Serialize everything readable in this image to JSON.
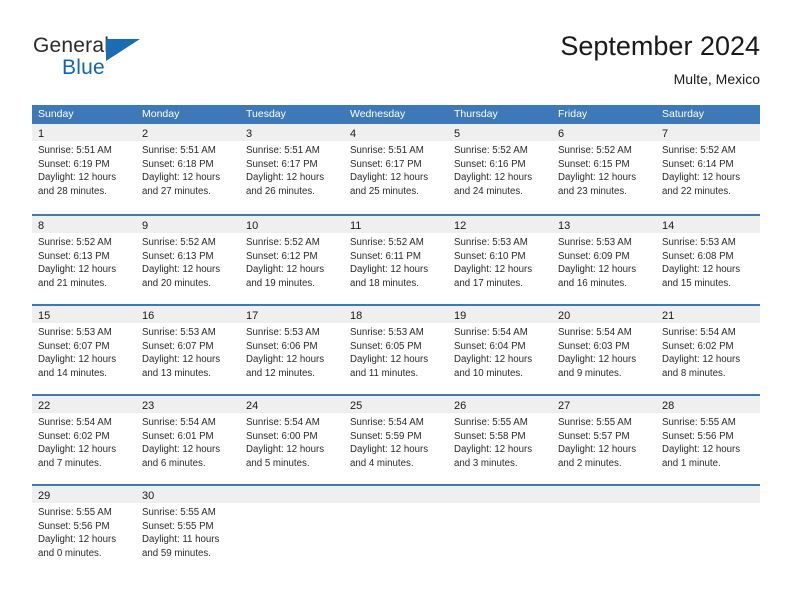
{
  "brand": {
    "word_general": "General",
    "word_blue": "Blue",
    "accent_color": "#1b6cb3"
  },
  "header": {
    "title": "September 2024",
    "location": "Multe, Mexico"
  },
  "theme": {
    "header_blue": "#3d79b9",
    "band_gray": "#efefef",
    "text_color": "#2a2a2a"
  },
  "weekdays": [
    "Sunday",
    "Monday",
    "Tuesday",
    "Wednesday",
    "Thursday",
    "Friday",
    "Saturday"
  ],
  "weeks": [
    [
      {
        "day": "1",
        "sunrise": "Sunrise: 5:51 AM",
        "sunset": "Sunset: 6:19 PM",
        "daylight1": "Daylight: 12 hours",
        "daylight2": "and 28 minutes."
      },
      {
        "day": "2",
        "sunrise": "Sunrise: 5:51 AM",
        "sunset": "Sunset: 6:18 PM",
        "daylight1": "Daylight: 12 hours",
        "daylight2": "and 27 minutes."
      },
      {
        "day": "3",
        "sunrise": "Sunrise: 5:51 AM",
        "sunset": "Sunset: 6:17 PM",
        "daylight1": "Daylight: 12 hours",
        "daylight2": "and 26 minutes."
      },
      {
        "day": "4",
        "sunrise": "Sunrise: 5:51 AM",
        "sunset": "Sunset: 6:17 PM",
        "daylight1": "Daylight: 12 hours",
        "daylight2": "and 25 minutes."
      },
      {
        "day": "5",
        "sunrise": "Sunrise: 5:52 AM",
        "sunset": "Sunset: 6:16 PM",
        "daylight1": "Daylight: 12 hours",
        "daylight2": "and 24 minutes."
      },
      {
        "day": "6",
        "sunrise": "Sunrise: 5:52 AM",
        "sunset": "Sunset: 6:15 PM",
        "daylight1": "Daylight: 12 hours",
        "daylight2": "and 23 minutes."
      },
      {
        "day": "7",
        "sunrise": "Sunrise: 5:52 AM",
        "sunset": "Sunset: 6:14 PM",
        "daylight1": "Daylight: 12 hours",
        "daylight2": "and 22 minutes."
      }
    ],
    [
      {
        "day": "8",
        "sunrise": "Sunrise: 5:52 AM",
        "sunset": "Sunset: 6:13 PM",
        "daylight1": "Daylight: 12 hours",
        "daylight2": "and 21 minutes."
      },
      {
        "day": "9",
        "sunrise": "Sunrise: 5:52 AM",
        "sunset": "Sunset: 6:13 PM",
        "daylight1": "Daylight: 12 hours",
        "daylight2": "and 20 minutes."
      },
      {
        "day": "10",
        "sunrise": "Sunrise: 5:52 AM",
        "sunset": "Sunset: 6:12 PM",
        "daylight1": "Daylight: 12 hours",
        "daylight2": "and 19 minutes."
      },
      {
        "day": "11",
        "sunrise": "Sunrise: 5:52 AM",
        "sunset": "Sunset: 6:11 PM",
        "daylight1": "Daylight: 12 hours",
        "daylight2": "and 18 minutes."
      },
      {
        "day": "12",
        "sunrise": "Sunrise: 5:53 AM",
        "sunset": "Sunset: 6:10 PM",
        "daylight1": "Daylight: 12 hours",
        "daylight2": "and 17 minutes."
      },
      {
        "day": "13",
        "sunrise": "Sunrise: 5:53 AM",
        "sunset": "Sunset: 6:09 PM",
        "daylight1": "Daylight: 12 hours",
        "daylight2": "and 16 minutes."
      },
      {
        "day": "14",
        "sunrise": "Sunrise: 5:53 AM",
        "sunset": "Sunset: 6:08 PM",
        "daylight1": "Daylight: 12 hours",
        "daylight2": "and 15 minutes."
      }
    ],
    [
      {
        "day": "15",
        "sunrise": "Sunrise: 5:53 AM",
        "sunset": "Sunset: 6:07 PM",
        "daylight1": "Daylight: 12 hours",
        "daylight2": "and 14 minutes."
      },
      {
        "day": "16",
        "sunrise": "Sunrise: 5:53 AM",
        "sunset": "Sunset: 6:07 PM",
        "daylight1": "Daylight: 12 hours",
        "daylight2": "and 13 minutes."
      },
      {
        "day": "17",
        "sunrise": "Sunrise: 5:53 AM",
        "sunset": "Sunset: 6:06 PM",
        "daylight1": "Daylight: 12 hours",
        "daylight2": "and 12 minutes."
      },
      {
        "day": "18",
        "sunrise": "Sunrise: 5:53 AM",
        "sunset": "Sunset: 6:05 PM",
        "daylight1": "Daylight: 12 hours",
        "daylight2": "and 11 minutes."
      },
      {
        "day": "19",
        "sunrise": "Sunrise: 5:54 AM",
        "sunset": "Sunset: 6:04 PM",
        "daylight1": "Daylight: 12 hours",
        "daylight2": "and 10 minutes."
      },
      {
        "day": "20",
        "sunrise": "Sunrise: 5:54 AM",
        "sunset": "Sunset: 6:03 PM",
        "daylight1": "Daylight: 12 hours",
        "daylight2": "and 9 minutes."
      },
      {
        "day": "21",
        "sunrise": "Sunrise: 5:54 AM",
        "sunset": "Sunset: 6:02 PM",
        "daylight1": "Daylight: 12 hours",
        "daylight2": "and 8 minutes."
      }
    ],
    [
      {
        "day": "22",
        "sunrise": "Sunrise: 5:54 AM",
        "sunset": "Sunset: 6:02 PM",
        "daylight1": "Daylight: 12 hours",
        "daylight2": "and 7 minutes."
      },
      {
        "day": "23",
        "sunrise": "Sunrise: 5:54 AM",
        "sunset": "Sunset: 6:01 PM",
        "daylight1": "Daylight: 12 hours",
        "daylight2": "and 6 minutes."
      },
      {
        "day": "24",
        "sunrise": "Sunrise: 5:54 AM",
        "sunset": "Sunset: 6:00 PM",
        "daylight1": "Daylight: 12 hours",
        "daylight2": "and 5 minutes."
      },
      {
        "day": "25",
        "sunrise": "Sunrise: 5:54 AM",
        "sunset": "Sunset: 5:59 PM",
        "daylight1": "Daylight: 12 hours",
        "daylight2": "and 4 minutes."
      },
      {
        "day": "26",
        "sunrise": "Sunrise: 5:55 AM",
        "sunset": "Sunset: 5:58 PM",
        "daylight1": "Daylight: 12 hours",
        "daylight2": "and 3 minutes."
      },
      {
        "day": "27",
        "sunrise": "Sunrise: 5:55 AM",
        "sunset": "Sunset: 5:57 PM",
        "daylight1": "Daylight: 12 hours",
        "daylight2": "and 2 minutes."
      },
      {
        "day": "28",
        "sunrise": "Sunrise: 5:55 AM",
        "sunset": "Sunset: 5:56 PM",
        "daylight1": "Daylight: 12 hours",
        "daylight2": "and 1 minute."
      }
    ],
    [
      {
        "day": "29",
        "sunrise": "Sunrise: 5:55 AM",
        "sunset": "Sunset: 5:56 PM",
        "daylight1": "Daylight: 12 hours",
        "daylight2": "and 0 minutes."
      },
      {
        "day": "30",
        "sunrise": "Sunrise: 5:55 AM",
        "sunset": "Sunset: 5:55 PM",
        "daylight1": "Daylight: 11 hours",
        "daylight2": "and 59 minutes."
      },
      {
        "day": "",
        "sunrise": "",
        "sunset": "",
        "daylight1": "",
        "daylight2": ""
      },
      {
        "day": "",
        "sunrise": "",
        "sunset": "",
        "daylight1": "",
        "daylight2": ""
      },
      {
        "day": "",
        "sunrise": "",
        "sunset": "",
        "daylight1": "",
        "daylight2": ""
      },
      {
        "day": "",
        "sunrise": "",
        "sunset": "",
        "daylight1": "",
        "daylight2": ""
      },
      {
        "day": "",
        "sunrise": "",
        "sunset": "",
        "daylight1": "",
        "daylight2": ""
      }
    ]
  ]
}
